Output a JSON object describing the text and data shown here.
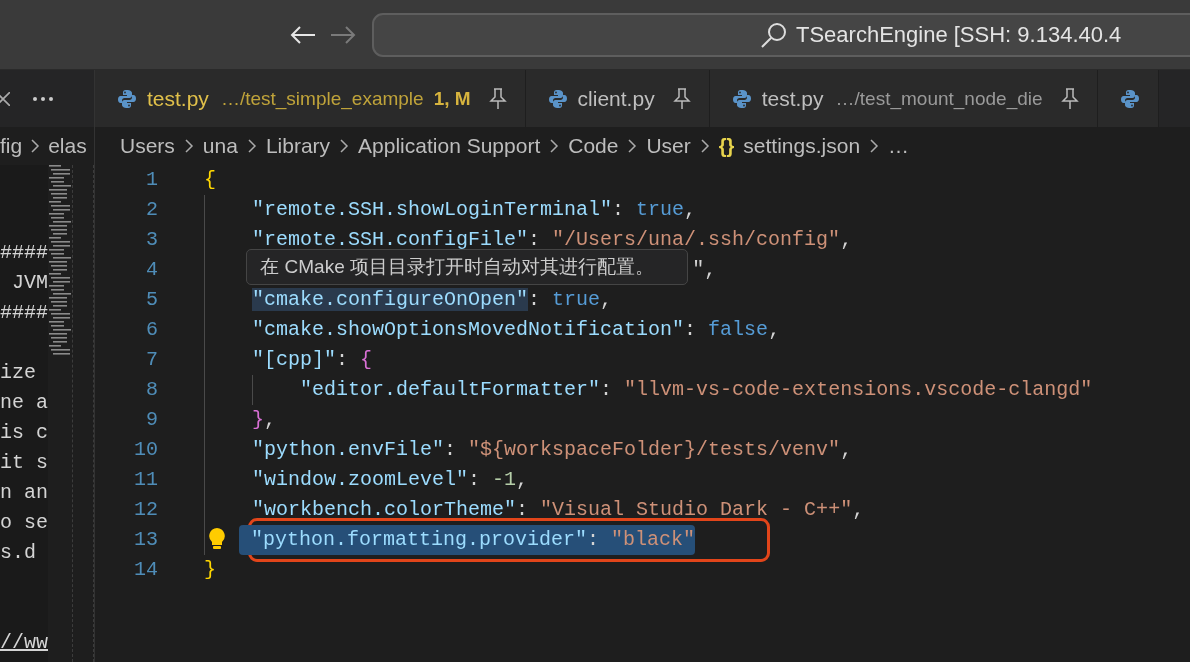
{
  "title_bar": {
    "nav": [
      {
        "kind": "back",
        "disabled": false
      },
      {
        "kind": "forward",
        "disabled": true
      }
    ],
    "search": {
      "value": "TSearchEngine [SSH: 9.134.40.4"
    }
  },
  "left_pane": {
    "breadcrumb": [
      "fig",
      "elas"
    ],
    "lines": [
      {
        "kind": "blank"
      },
      {
        "kind": "blank"
      },
      {
        "kind": "code",
        "text": "####"
      },
      {
        "kind": "code",
        "text": " JVM"
      },
      {
        "kind": "code",
        "text": "####"
      },
      {
        "kind": "blank"
      },
      {
        "kind": "code",
        "text": "ize"
      },
      {
        "kind": "code",
        "text": "ne a"
      },
      {
        "kind": "code",
        "text": "is c"
      },
      {
        "kind": "code",
        "text": "it s"
      },
      {
        "kind": "code",
        "text": "n an"
      },
      {
        "kind": "code",
        "text": "o se"
      },
      {
        "kind": "code",
        "text": "s.d"
      },
      {
        "kind": "blank"
      },
      {
        "kind": "blank"
      },
      {
        "kind": "link",
        "text": "//ww"
      }
    ]
  },
  "tabs": [
    {
      "kind": "file",
      "name": "test.py",
      "description": "…/test_simple_example",
      "decoration": "1, M",
      "modified": true,
      "pinned": true,
      "selected": false
    },
    {
      "kind": "file",
      "name": "client.py",
      "modified": false,
      "pinned": true,
      "selected": false
    },
    {
      "kind": "file",
      "name": "test.py",
      "description": "…/test_mount_node_die",
      "modified": false,
      "pinned": true,
      "selected": false
    },
    {
      "kind": "icon-only",
      "selected": false
    }
  ],
  "breadcrumb": [
    {
      "text": "Users"
    },
    {
      "text": "una"
    },
    {
      "text": "Library"
    },
    {
      "text": "Application Support"
    },
    {
      "text": "Code"
    },
    {
      "text": "User"
    },
    {
      "text": "settings.json",
      "icon": "{}"
    },
    {
      "text": "…"
    }
  ],
  "editor": {
    "lines": [
      {
        "number": "1",
        "selected": false,
        "outlined": false,
        "lightbulb": false,
        "tokens": [
          {
            "text": "{",
            "kind": "bracket"
          }
        ]
      },
      {
        "number": "2",
        "selected": false,
        "outlined": false,
        "lightbulb": false,
        "tokens": [
          {
            "text": "    \"remote.SSH.showLoginTerminal\"",
            "kind": "key"
          },
          {
            "text": ": ",
            "kind": "punct"
          },
          {
            "text": "true",
            "kind": "keyword"
          },
          {
            "text": ",",
            "kind": "punct"
          }
        ]
      },
      {
        "number": "3",
        "selected": false,
        "outlined": false,
        "lightbulb": false,
        "tokens": [
          {
            "text": "    \"remote.SSH.configFile\"",
            "kind": "key"
          },
          {
            "text": ": ",
            "kind": "punct"
          },
          {
            "text": "\"/Users/una/.ssh/config\"",
            "kind": "string"
          },
          {
            "text": ",",
            "kind": "punct"
          }
        ]
      },
      {
        "number": "4",
        "selected": false,
        "outlined": false,
        "lightbulb": false,
        "tooltip": "在 CMake 项目目录打开时自动对其进行配置。",
        "tokens": [
          {
            "text": "\",",
            "kind": "punct"
          }
        ]
      },
      {
        "number": "5",
        "selected": false,
        "outlined": false,
        "lightbulb": false,
        "tokens": [
          {
            "text": "    \"cmake.configureOnOpen\"",
            "kind": "key-highlighted"
          },
          {
            "text": ": ",
            "kind": "punct"
          },
          {
            "text": "true",
            "kind": "keyword"
          },
          {
            "text": ",",
            "kind": "punct"
          }
        ]
      },
      {
        "number": "6",
        "selected": false,
        "outlined": false,
        "lightbulb": false,
        "tokens": [
          {
            "text": "    \"cmake.showOptionsMovedNotification\"",
            "kind": "key"
          },
          {
            "text": ": ",
            "kind": "punct"
          },
          {
            "text": "false",
            "kind": "keyword"
          },
          {
            "text": ",",
            "kind": "punct"
          }
        ]
      },
      {
        "number": "7",
        "selected": false,
        "outlined": false,
        "lightbulb": false,
        "tokens": [
          {
            "text": "    \"[cpp]\"",
            "kind": "key"
          },
          {
            "text": ": ",
            "kind": "punct"
          },
          {
            "text": "{",
            "kind": "bracket2"
          }
        ]
      },
      {
        "number": "8",
        "selected": false,
        "outlined": false,
        "lightbulb": false,
        "tokens": [
          {
            "text": "        \"editor.defaultFormatter\"",
            "kind": "key"
          },
          {
            "text": ": ",
            "kind": "punct"
          },
          {
            "text": "\"llvm-vs-code-extensions.vscode-clangd\"",
            "kind": "string"
          }
        ]
      },
      {
        "number": "9",
        "selected": false,
        "outlined": false,
        "lightbulb": false,
        "tokens": [
          {
            "text": "    }",
            "kind": "bracket2"
          },
          {
            "text": ",",
            "kind": "punct"
          }
        ]
      },
      {
        "number": "10",
        "selected": false,
        "outlined": false,
        "lightbulb": false,
        "tokens": [
          {
            "text": "    \"python.envFile\"",
            "kind": "key"
          },
          {
            "text": ": ",
            "kind": "punct"
          },
          {
            "text": "\"${workspaceFolder}/tests/venv\"",
            "kind": "string"
          },
          {
            "text": ",",
            "kind": "punct"
          }
        ]
      },
      {
        "number": "11",
        "selected": false,
        "outlined": false,
        "lightbulb": false,
        "tokens": [
          {
            "text": "    \"window.zoomLevel\"",
            "kind": "key"
          },
          {
            "text": ": ",
            "kind": "punct"
          },
          {
            "text": "-1",
            "kind": "number"
          },
          {
            "text": ",",
            "kind": "punct"
          }
        ]
      },
      {
        "number": "12",
        "selected": false,
        "outlined": false,
        "lightbulb": false,
        "tokens": [
          {
            "text": "    \"workbench.colorTheme\"",
            "kind": "key"
          },
          {
            "text": ": ",
            "kind": "punct"
          },
          {
            "text": "\"Visual Studio Dark - C++\"",
            "kind": "string"
          },
          {
            "text": ",",
            "kind": "punct"
          }
        ]
      },
      {
        "number": "13",
        "selected": true,
        "outlined": true,
        "lightbulb": true,
        "tokens": [
          {
            "text": "    \"python.formatting.provider\"",
            "kind": "key"
          },
          {
            "text": ": ",
            "kind": "punct"
          },
          {
            "text": "\"black\"",
            "kind": "string"
          }
        ]
      },
      {
        "number": "14",
        "selected": false,
        "outlined": false,
        "lightbulb": false,
        "tokens": [
          {
            "text": "}",
            "kind": "bracket"
          }
        ]
      }
    ]
  }
}
